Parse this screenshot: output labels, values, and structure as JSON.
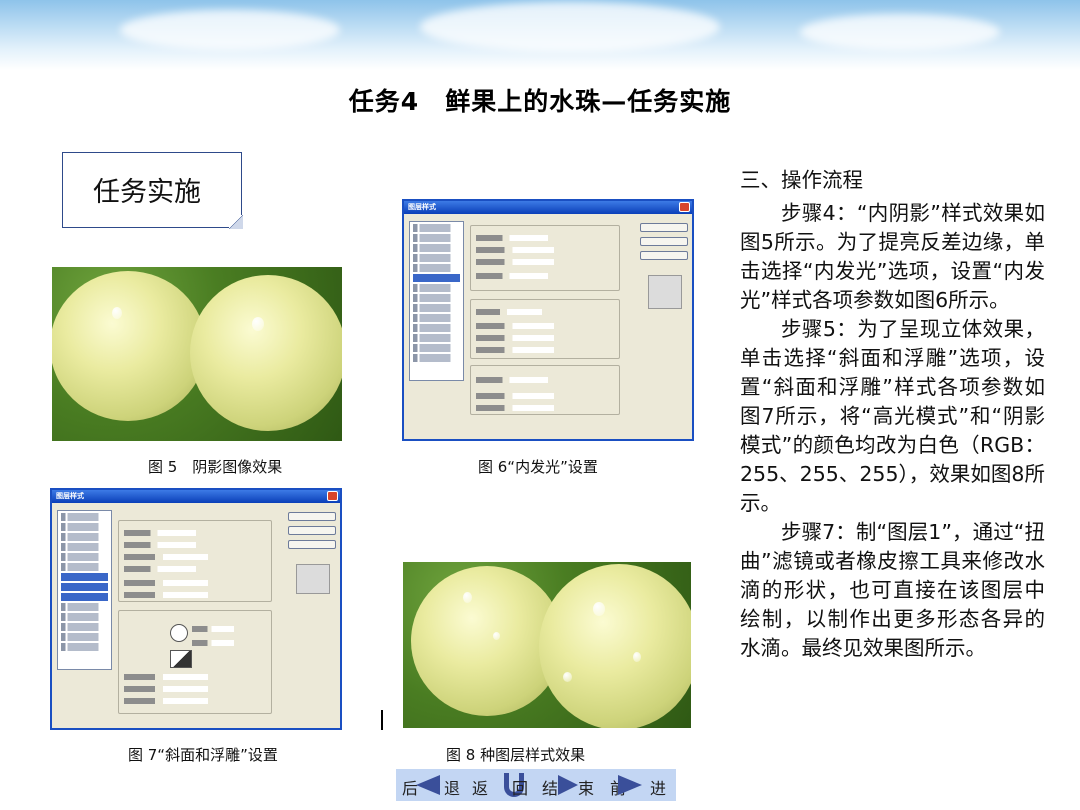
{
  "slide": {
    "title": "任务4　鲜果上的水珠—任务实施",
    "note_label": "任务实施"
  },
  "figures": {
    "fig5_caption": "图 5　阴影图像效果",
    "fig6_caption": "图 6“内发光”设置",
    "fig7_caption": "图 7“斜面和浮雕”设置",
    "fig8_caption": "图 8 种图层样式效果",
    "dialog_title": "图层样式"
  },
  "content": {
    "heading": "三、操作流程",
    "paragraphs": [
      "步骤4：“内阴影”样式效果如图5所示。为了提亮反差边缘，单击选择“内发光”选项，设置“内发光”样式各项参数如图6所示。",
      "步骤5：为了呈现立体效果，单击选择“斜面和浮雕”选项，设置“斜面和浮雕”样式各项参数如图7所示，将“高光模式”和“阴影模式”的颜色均改为白色（RGB：255、255、255），效果如图8所示。",
      "步骤7：制“图层1”，通过“扭曲”滤镜或者橡皮擦工具来修改水滴的形状，也可直接在该图层中绘制，以制作出更多形态各异的水滴。最终见效果图所示。"
    ]
  },
  "nav": {
    "back_1": "后",
    "back_2": "退",
    "return_1": "返",
    "return_2": "回",
    "end_1": "结",
    "end_2": "束",
    "fwd_1": "前",
    "fwd_2": "进"
  }
}
